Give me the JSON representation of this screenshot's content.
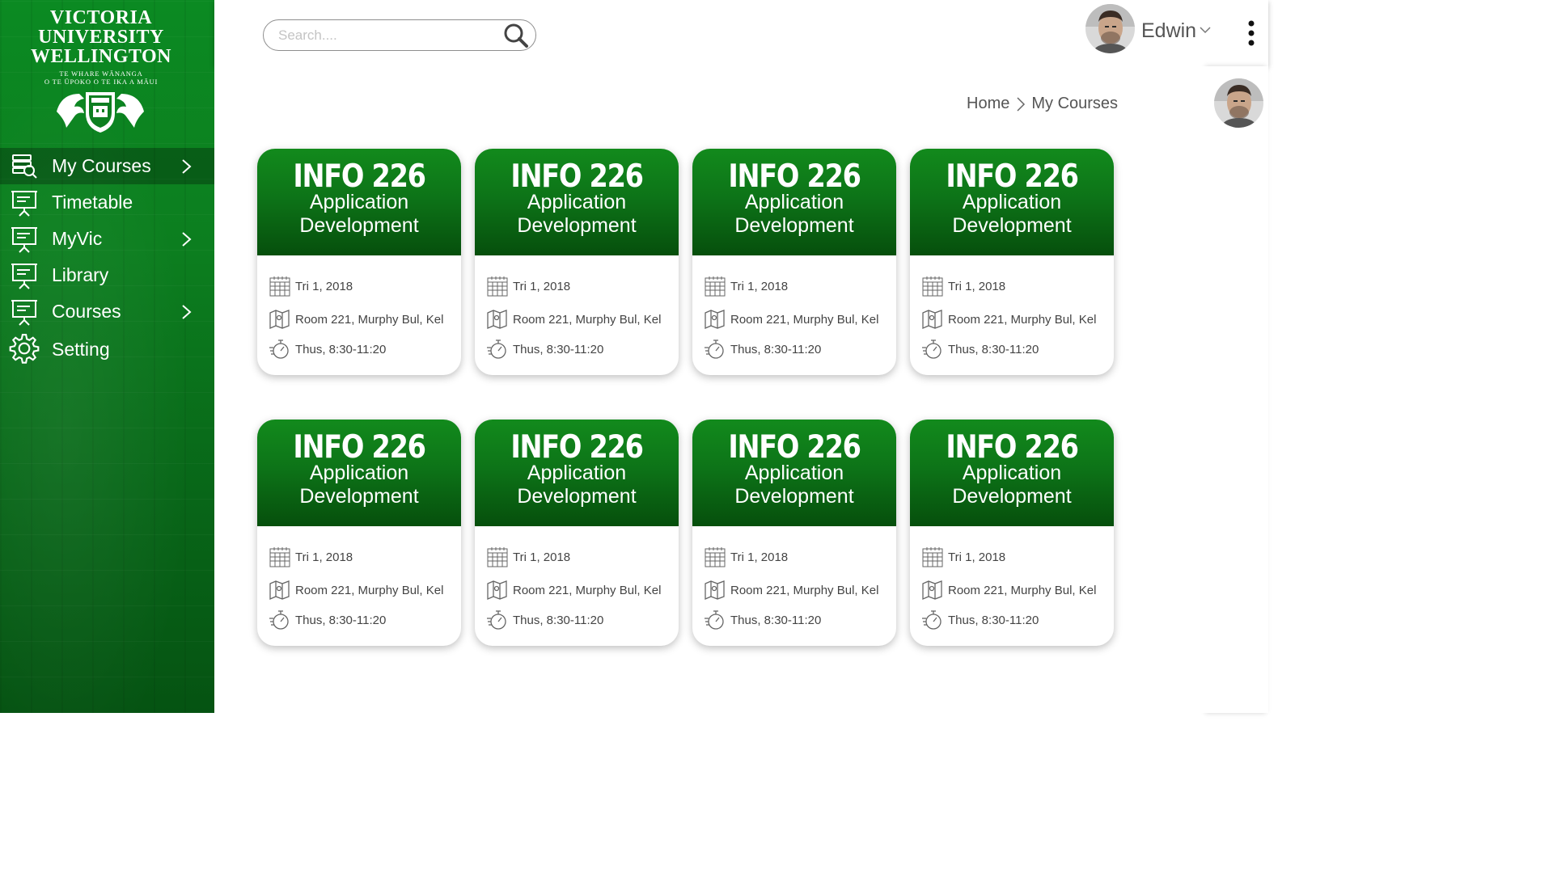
{
  "sidebar": {
    "logo": {
      "line1": "VICTORIA",
      "line2": "UNIVERSITY",
      "line3": "WELLINGTON",
      "tagline1": "TE WHARE WĀNANGA",
      "tagline2": "O TE ŪPOKO O TE IKA A MĀUI"
    },
    "items": [
      {
        "label": "My Courses",
        "icon": "course-search-icon",
        "chevron": true,
        "active": true
      },
      {
        "label": "Timetable",
        "icon": "presentation-board-icon",
        "chevron": false,
        "active": false
      },
      {
        "label": "MyVic",
        "icon": "presentation-board-icon",
        "chevron": true,
        "active": false
      },
      {
        "label": "Library",
        "icon": "presentation-board-icon",
        "chevron": false,
        "active": false
      },
      {
        "label": "Courses",
        "icon": "presentation-board-icon",
        "chevron": true,
        "active": false
      },
      {
        "label": "Setting",
        "icon": "gear-icon",
        "chevron": false,
        "active": false
      }
    ]
  },
  "header": {
    "search": {
      "placeholder": "Search...."
    },
    "user": {
      "name": "Edwin"
    }
  },
  "breadcrumb": {
    "home": "Home",
    "current": "My Courses"
  },
  "colors": {
    "brand_green": "#0c7e1f",
    "card_header_top": "#128a1c",
    "card_header_bottom": "#064f0c"
  },
  "courses": [
    {
      "code": "INFO 226",
      "name_line1": "Application",
      "name_line2": "Development",
      "term": "Tri 1, 2018",
      "room": "Room 221, Murphy Bul, Kel",
      "time": "Thus, 8:30-11:20"
    },
    {
      "code": "INFO 226",
      "name_line1": "Application",
      "name_line2": "Development",
      "term": "Tri 1, 2018",
      "room": "Room 221, Murphy Bul, Kel",
      "time": "Thus, 8:30-11:20"
    },
    {
      "code": "INFO 226",
      "name_line1": "Application",
      "name_line2": "Development",
      "term": "Tri 1, 2018",
      "room": "Room 221, Murphy Bul, Kel",
      "time": "Thus, 8:30-11:20"
    },
    {
      "code": "INFO 226",
      "name_line1": "Application",
      "name_line2": "Development",
      "term": "Tri 1, 2018",
      "room": "Room 221, Murphy Bul, Kel",
      "time": "Thus, 8:30-11:20"
    },
    {
      "code": "INFO 226",
      "name_line1": "Application",
      "name_line2": "Development",
      "term": "Tri 1, 2018",
      "room": "Room 221, Murphy Bul, Kel",
      "time": "Thus, 8:30-11:20"
    },
    {
      "code": "INFO 226",
      "name_line1": "Application",
      "name_line2": "Development",
      "term": "Tri 1, 2018",
      "room": "Room 221, Murphy Bul, Kel",
      "time": "Thus, 8:30-11:20"
    },
    {
      "code": "INFO 226",
      "name_line1": "Application",
      "name_line2": "Development",
      "term": "Tri 1, 2018",
      "room": "Room 221, Murphy Bul, Kel",
      "time": "Thus, 8:30-11:20"
    },
    {
      "code": "INFO 226",
      "name_line1": "Application",
      "name_line2": "Development",
      "term": "Tri 1, 2018",
      "room": "Room 221, Murphy Bul, Kel",
      "time": "Thus, 8:30-11:20"
    }
  ]
}
